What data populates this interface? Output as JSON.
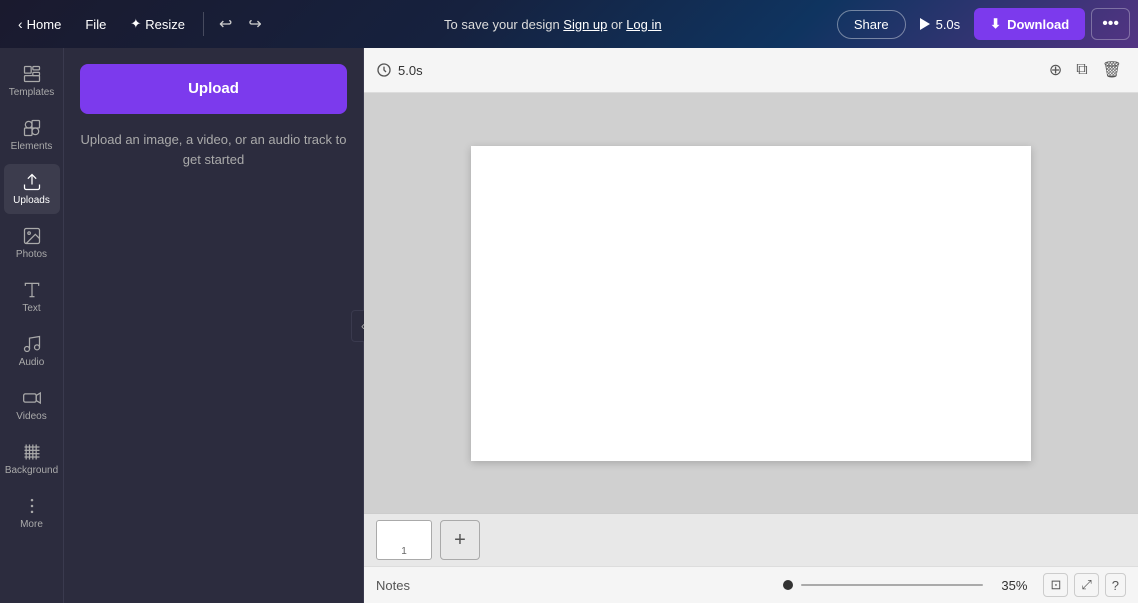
{
  "topbar": {
    "home_label": "Home",
    "file_label": "File",
    "resize_label": "Resize",
    "save_prompt": "To save your design",
    "sign_up_label": "Sign up",
    "or_label": "or",
    "log_in_label": "Log in",
    "share_label": "Share",
    "duration_label": "5.0s",
    "download_label": "Download",
    "more_icon": "•••"
  },
  "sidebar": {
    "items": [
      {
        "id": "templates",
        "label": "Templates"
      },
      {
        "id": "elements",
        "label": "Elements"
      },
      {
        "id": "uploads",
        "label": "Uploads"
      },
      {
        "id": "photos",
        "label": "Photos"
      },
      {
        "id": "text",
        "label": "Text"
      },
      {
        "id": "audio",
        "label": "Audio"
      },
      {
        "id": "videos",
        "label": "Videos"
      },
      {
        "id": "background",
        "label": "Background"
      },
      {
        "id": "more",
        "label": "More"
      }
    ]
  },
  "panel": {
    "upload_btn_label": "Upload",
    "upload_hint": "Upload an image, a video, or an audio track to get started",
    "collapse_icon": "‹"
  },
  "canvas": {
    "timer": "5.0s",
    "page_number": "1",
    "add_page_label": "+"
  },
  "notes_bar": {
    "label": "Notes",
    "zoom_pct": "35%"
  }
}
